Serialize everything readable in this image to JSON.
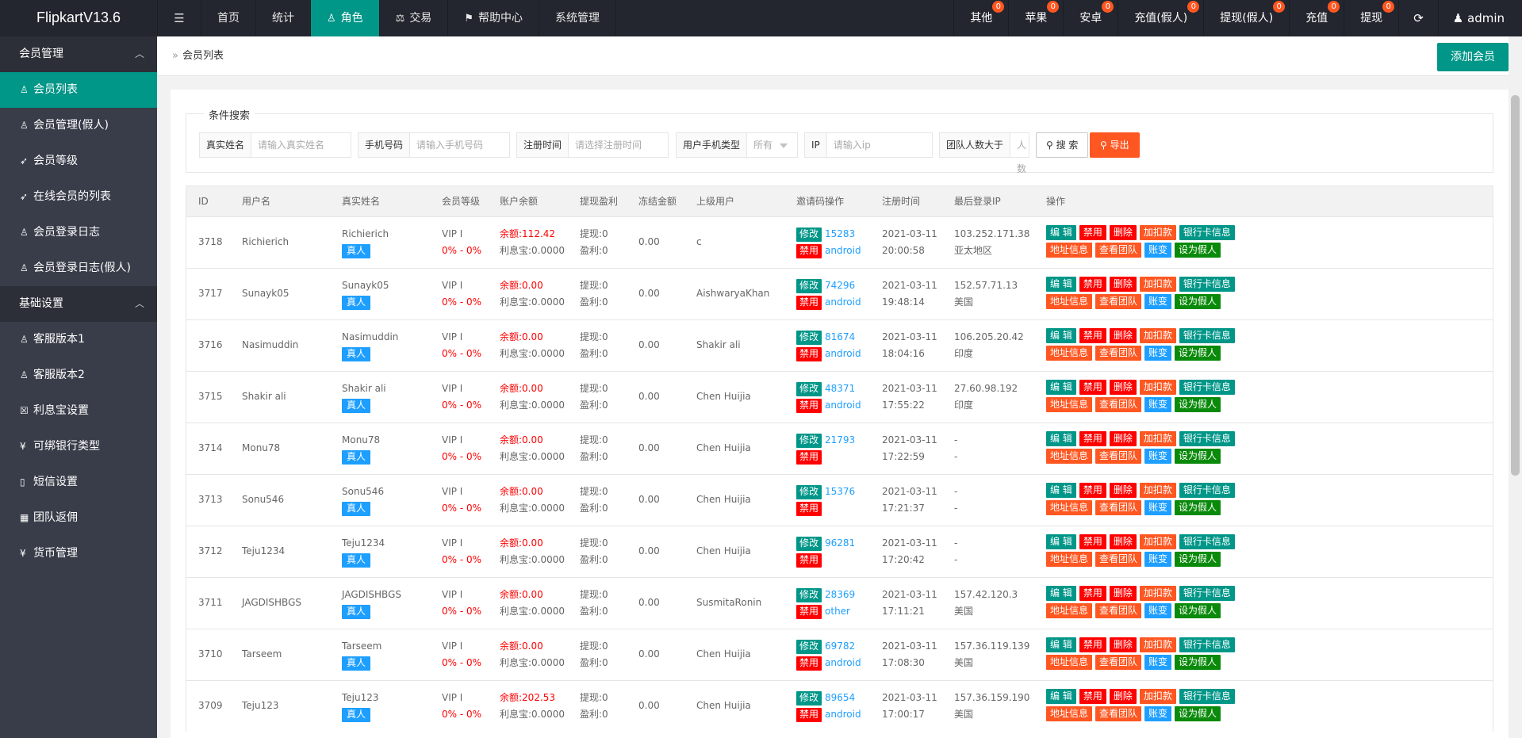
{
  "app": {
    "title": "FlipkartV13.6"
  },
  "nav": [
    {
      "label": "首页",
      "icon": "",
      "active": false
    },
    {
      "label": "统计",
      "icon": "",
      "active": false
    },
    {
      "label": "角色",
      "icon": "user-icon",
      "active": true
    },
    {
      "label": "交易",
      "icon": "scale-icon",
      "active": false
    },
    {
      "label": "帮助中心",
      "icon": "flag-icon",
      "active": false
    },
    {
      "label": "系统管理",
      "icon": "",
      "active": false
    }
  ],
  "right_nav": [
    {
      "label": "其他",
      "badge": "0"
    },
    {
      "label": "苹果",
      "badge": "0"
    },
    {
      "label": "安卓",
      "badge": "0"
    },
    {
      "label": "充值(假人)",
      "badge": "0"
    },
    {
      "label": "提现(假人)",
      "badge": "0"
    },
    {
      "label": "充值",
      "badge": "0"
    },
    {
      "label": "提现",
      "badge": "0"
    }
  ],
  "user": {
    "name": "admin"
  },
  "sidebar": {
    "groups": [
      {
        "label": "会员管理",
        "items": [
          {
            "label": "会员列表",
            "icon": "user-icon",
            "active": true
          },
          {
            "label": "会员管理(假人)",
            "icon": "user-icon",
            "active": false
          },
          {
            "label": "会员等级",
            "icon": "rocket-icon",
            "active": false
          },
          {
            "label": "在线会员的列表",
            "icon": "rocket-icon",
            "active": false
          },
          {
            "label": "会员登录日志",
            "icon": "user-icon",
            "active": false
          },
          {
            "label": "会员登录日志(假人)",
            "icon": "user-icon",
            "active": false
          }
        ]
      },
      {
        "label": "基础设置",
        "items": [
          {
            "label": "客服版本1",
            "icon": "user-icon",
            "active": false
          },
          {
            "label": "客服版本2",
            "icon": "user-icon",
            "active": false
          },
          {
            "label": "利息宝设置",
            "icon": "lock-icon",
            "active": false
          },
          {
            "label": "可绑银行类型",
            "icon": "yen-icon",
            "active": false
          },
          {
            "label": "短信设置",
            "icon": "phone-icon",
            "active": false
          },
          {
            "label": "团队返佣",
            "icon": "grid-icon",
            "active": false
          },
          {
            "label": "货币管理",
            "icon": "yen-icon",
            "active": false
          }
        ]
      }
    ]
  },
  "breadcrumb": "会员列表",
  "add_button": "添加会员",
  "search": {
    "legend": "条件搜索",
    "fields": [
      {
        "label": "真实姓名",
        "placeholder": "请输入真实姓名"
      },
      {
        "label": "手机号码",
        "placeholder": "请输入手机号码"
      },
      {
        "label": "注册时间",
        "placeholder": "请选择注册时间"
      },
      {
        "label": "用户手机类型",
        "placeholder": "所有"
      },
      {
        "label": "IP",
        "placeholder": "请输入ip"
      },
      {
        "label": "团队人数大于",
        "placeholder": "人数"
      }
    ],
    "search_button": "搜 索",
    "export_button": "导出"
  },
  "table": {
    "columns": [
      "ID",
      "用户名",
      "真实姓名",
      "会员等级",
      "账户余额",
      "提现盈利",
      "冻结金额",
      "上级用户",
      "邀请码操作",
      "注册时间",
      "最后登录IP",
      "操作"
    ],
    "labels": {
      "real": "真人",
      "balance_prefix": "余额:",
      "interest_prefix": "利息宝:",
      "withdraw_prefix": "提现:",
      "profit_prefix": "盈利:",
      "edit_code": "修改",
      "disable_code": "禁用"
    },
    "actions_row1": [
      "编 辑",
      "禁用",
      "删除",
      "加扣款",
      "银行卡信息"
    ],
    "actions_row2": [
      "地址信息",
      "查看团队",
      "账变",
      "设为假人"
    ],
    "rows": [
      {
        "id": "3718",
        "username": "Richierich",
        "realname": "Richierich",
        "level": "VIP I",
        "rate": "0% - 0%",
        "balance": "112.42",
        "interest": "0.0000",
        "withdraw": "0",
        "profit": "0",
        "frozen": "0.00",
        "parent": "c",
        "code": "15283",
        "device": "android",
        "reg_date": "2021-03-11",
        "reg_time": "20:00:58",
        "ip": "103.252.171.38",
        "region": "亚太地区"
      },
      {
        "id": "3717",
        "username": "Sunayk05",
        "realname": "Sunayk05",
        "level": "VIP I",
        "rate": "0% - 0%",
        "balance": "0.00",
        "interest": "0.0000",
        "withdraw": "0",
        "profit": "0",
        "frozen": "0.00",
        "parent": "AishwaryaKhan",
        "code": "74296",
        "device": "android",
        "reg_date": "2021-03-11",
        "reg_time": "19:48:14",
        "ip": "152.57.71.13",
        "region": "美国"
      },
      {
        "id": "3716",
        "username": "Nasimuddin",
        "realname": "Nasimuddin",
        "level": "VIP I",
        "rate": "0% - 0%",
        "balance": "0.00",
        "interest": "0.0000",
        "withdraw": "0",
        "profit": "0",
        "frozen": "0.00",
        "parent": "Shakir ali",
        "code": "81674",
        "device": "android",
        "reg_date": "2021-03-11",
        "reg_time": "18:04:16",
        "ip": "106.205.20.42",
        "region": "印度"
      },
      {
        "id": "3715",
        "username": "Shakir ali",
        "realname": "Shakir ali",
        "level": "VIP I",
        "rate": "0% - 0%",
        "balance": "0.00",
        "interest": "0.0000",
        "withdraw": "0",
        "profit": "0",
        "frozen": "0.00",
        "parent": "Chen Huijia",
        "code": "48371",
        "device": "android",
        "reg_date": "2021-03-11",
        "reg_time": "17:55:22",
        "ip": "27.60.98.192",
        "region": "印度"
      },
      {
        "id": "3714",
        "username": "Monu78",
        "realname": "Monu78",
        "level": "VIP I",
        "rate": "0% - 0%",
        "balance": "0.00",
        "interest": "0.0000",
        "withdraw": "0",
        "profit": "0",
        "frozen": "0.00",
        "parent": "Chen Huijia",
        "code": "21793",
        "device": "",
        "reg_date": "2021-03-11",
        "reg_time": "17:22:59",
        "ip": "-",
        "region": "-"
      },
      {
        "id": "3713",
        "username": "Sonu546",
        "realname": "Sonu546",
        "level": "VIP I",
        "rate": "0% - 0%",
        "balance": "0.00",
        "interest": "0.0000",
        "withdraw": "0",
        "profit": "0",
        "frozen": "0.00",
        "parent": "Chen Huijia",
        "code": "15376",
        "device": "",
        "reg_date": "2021-03-11",
        "reg_time": "17:21:37",
        "ip": "-",
        "region": "-"
      },
      {
        "id": "3712",
        "username": "Teju1234",
        "realname": "Teju1234",
        "level": "VIP I",
        "rate": "0% - 0%",
        "balance": "0.00",
        "interest": "0.0000",
        "withdraw": "0",
        "profit": "0",
        "frozen": "0.00",
        "parent": "Chen Huijia",
        "code": "96281",
        "device": "",
        "reg_date": "2021-03-11",
        "reg_time": "17:20:42",
        "ip": "-",
        "region": "-"
      },
      {
        "id": "3711",
        "username": "JAGDISHBGS",
        "realname": "JAGDISHBGS",
        "level": "VIP I",
        "rate": "0% - 0%",
        "balance": "0.00",
        "interest": "0.0000",
        "withdraw": "0",
        "profit": "0",
        "frozen": "0.00",
        "parent": "SusmitaRonin",
        "code": "28369",
        "device": "other",
        "reg_date": "2021-03-11",
        "reg_time": "17:11:21",
        "ip": "157.42.120.3",
        "region": "美国"
      },
      {
        "id": "3710",
        "username": "Tarseem",
        "realname": "Tarseem",
        "level": "VIP I",
        "rate": "0% - 0%",
        "balance": "0.00",
        "interest": "0.0000",
        "withdraw": "0",
        "profit": "0",
        "frozen": "0.00",
        "parent": "Chen Huijia",
        "code": "69782",
        "device": "android",
        "reg_date": "2021-03-11",
        "reg_time": "17:08:30",
        "ip": "157.36.119.139",
        "region": "美国"
      },
      {
        "id": "3709",
        "username": "Teju123",
        "realname": "Teju123",
        "level": "VIP I",
        "rate": "0% - 0%",
        "balance": "202.53",
        "interest": "0.0000",
        "withdraw": "0",
        "profit": "0",
        "frozen": "0.00",
        "parent": "Chen Huijia",
        "code": "89654",
        "device": "android",
        "reg_date": "2021-03-11",
        "reg_time": "17:00:17",
        "ip": "157.36.159.190",
        "region": "美国"
      }
    ]
  }
}
